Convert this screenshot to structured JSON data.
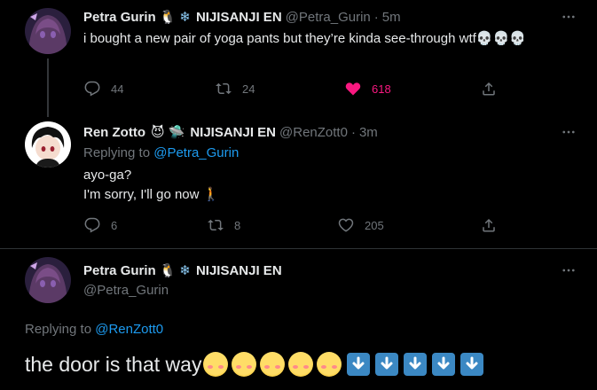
{
  "tweets": [
    {
      "display_name": "Petra Gurin",
      "name_emojis": [
        "🐧",
        "❄"
      ],
      "affiliation": "NIJISANJI EN",
      "handle": "@Petra_Gurin",
      "dot": "·",
      "time": "5m",
      "text": "i bought a new pair of yoga pants but they’re kinda see-through wtf💀💀💀",
      "replies": "44",
      "retweets": "24",
      "likes": "618",
      "liked": true
    },
    {
      "display_name": "Ren Zotto",
      "name_emojis": [
        "😈",
        "🛸"
      ],
      "affiliation": "NIJISANJI EN",
      "handle": "@RenZott0",
      "dot": "·",
      "time": "3m",
      "replying_label": "Replying to",
      "replying_to": "@Petra_Gurin",
      "text_line1": "ayo-ga?",
      "text_line2": "I'm sorry, I'll go now 🚶",
      "replies": "6",
      "retweets": "8",
      "likes": "205"
    },
    {
      "display_name": "Petra Gurin",
      "name_emojis": [
        "🐧",
        "❄"
      ],
      "affiliation": "NIJISANJI EN",
      "handle": "@Petra_Gurin",
      "replying_label": "Replying to",
      "replying_to": "@RenZott0",
      "text": "the door is that way"
    }
  ],
  "colors": {
    "background": "#000000",
    "text": "#e7e9ea",
    "muted": "#71767b",
    "link": "#1d9bf0",
    "like": "#f91880"
  },
  "icons": [
    "more-icon",
    "reply-icon",
    "retweet-icon",
    "heart-icon",
    "share-icon",
    "skull-icon",
    "blush-face-icon",
    "down-arrow-icon"
  ]
}
